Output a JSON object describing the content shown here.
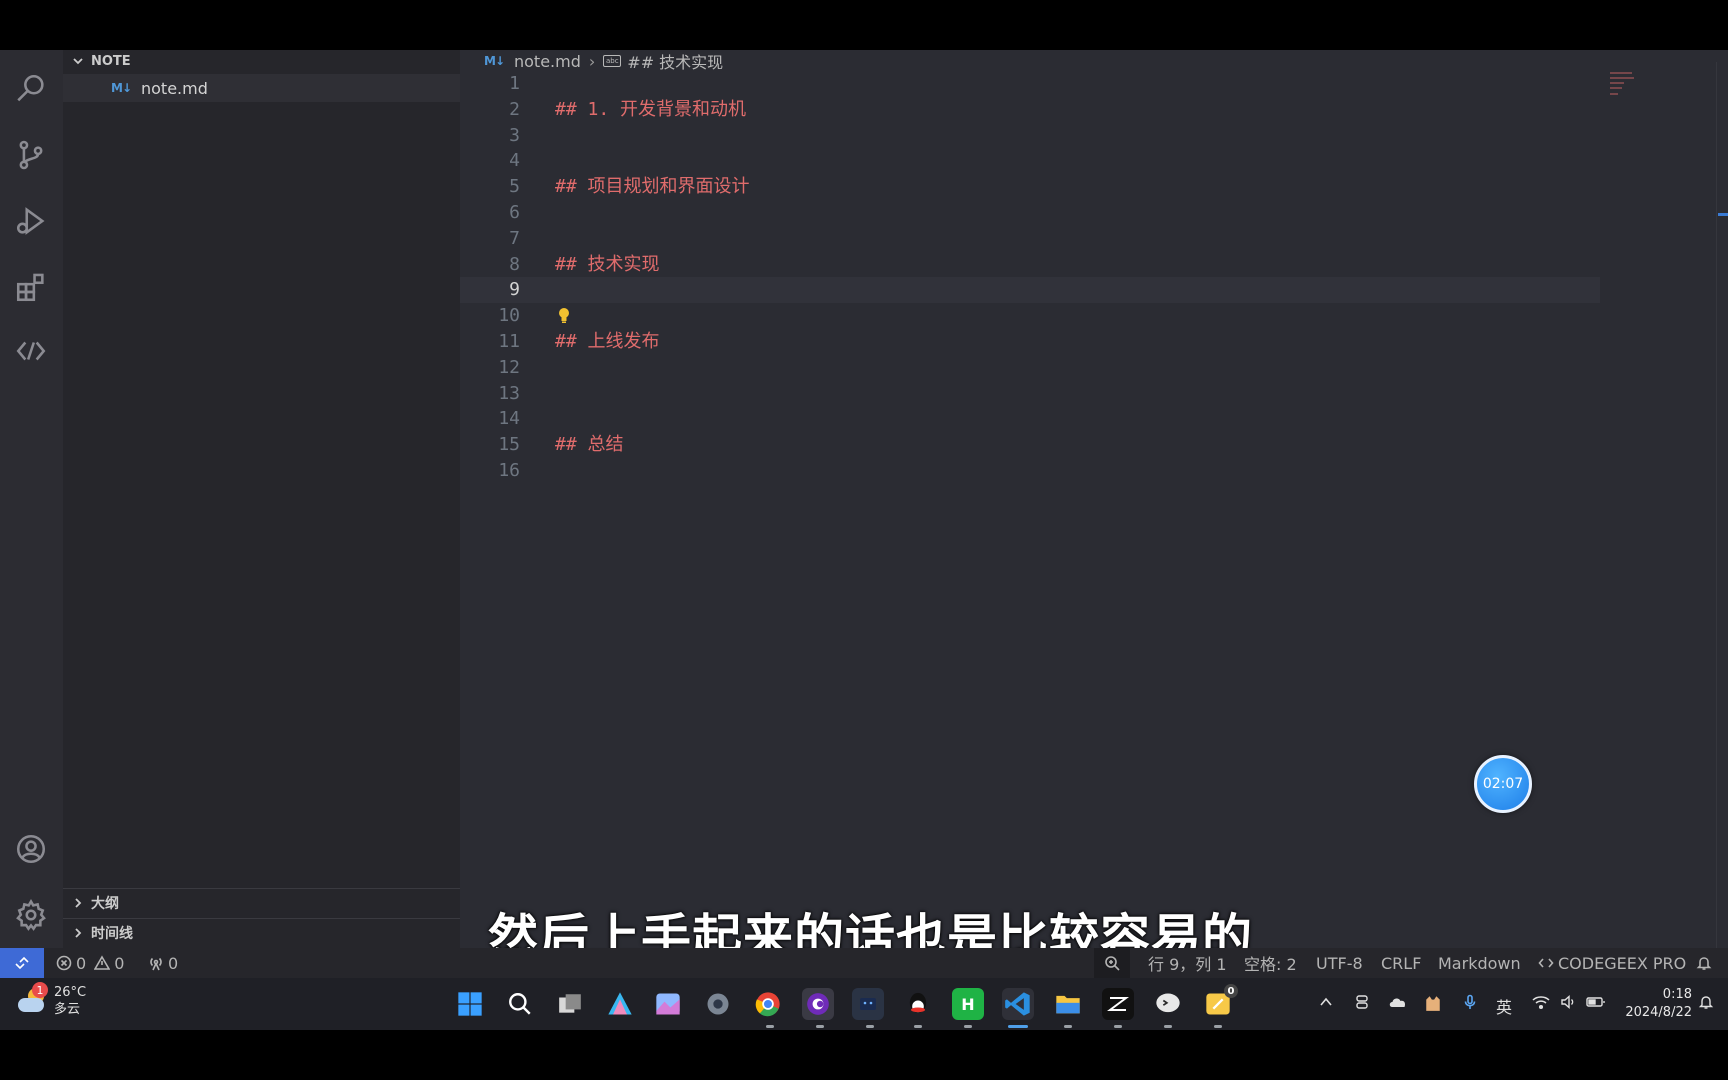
{
  "explorer": {
    "folder": "NOTE",
    "file": "note.md",
    "file_icon": "M↓",
    "outline": "大纲",
    "timeline": "时间线"
  },
  "breadcrumb": {
    "file": "note.md",
    "symbol": "## 技术实现"
  },
  "editor": {
    "active_line": 9,
    "lines": [
      {
        "n": "1",
        "text": ""
      },
      {
        "n": "2",
        "text": "## 1. 开发背景和动机"
      },
      {
        "n": "3",
        "text": ""
      },
      {
        "n": "4",
        "text": ""
      },
      {
        "n": "5",
        "text": "## 项目规划和界面设计"
      },
      {
        "n": "6",
        "text": ""
      },
      {
        "n": "7",
        "text": ""
      },
      {
        "n": "8",
        "text": "## 技术实现"
      },
      {
        "n": "9",
        "text": ""
      },
      {
        "n": "10",
        "text": ""
      },
      {
        "n": "11",
        "text": "## 上线发布"
      },
      {
        "n": "12",
        "text": ""
      },
      {
        "n": "13",
        "text": ""
      },
      {
        "n": "14",
        "text": ""
      },
      {
        "n": "15",
        "text": "## 总结"
      },
      {
        "n": "16",
        "text": ""
      }
    ],
    "heading_color": "#e06c6c"
  },
  "timer": "02:07",
  "subtitle": "然后上手起来的话也是比较容易的",
  "status": {
    "errors": "0",
    "warnings": "0",
    "ports": "0",
    "position": "行 9，列 1",
    "spaces": "空格: 2",
    "encoding": "UTF-8",
    "eol": "CRLF",
    "language": "Markdown",
    "extension": "CODEGEEX PRO"
  },
  "taskbar": {
    "temperature": "26°C",
    "weather": "多云",
    "weather_badge": "1",
    "app_badge": "0",
    "ime": "英",
    "time": "0:18",
    "date": "2024/8/22"
  },
  "colors": {
    "accent": "#3e6ad6",
    "editor_bg": "#2b2c33",
    "sidebar_bg": "#26262b"
  }
}
